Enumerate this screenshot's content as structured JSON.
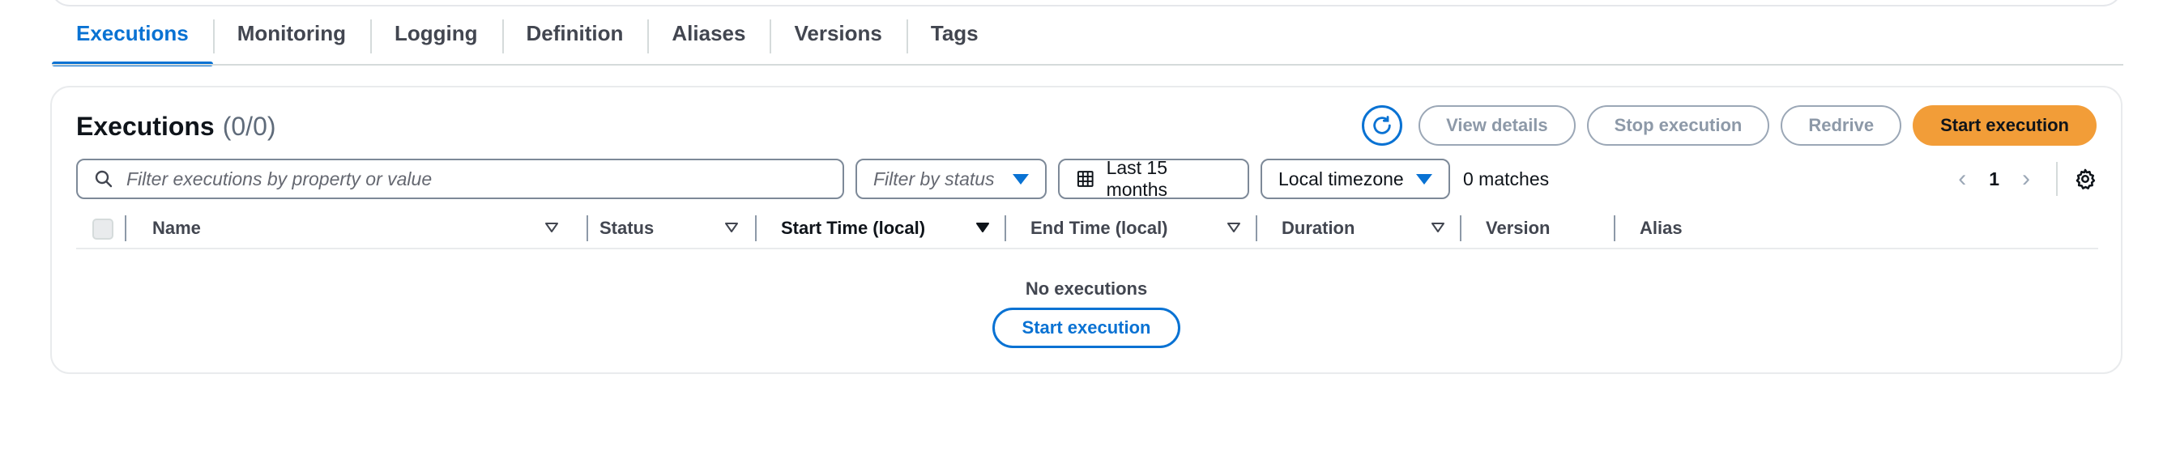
{
  "tabs": [
    {
      "label": "Executions",
      "active": true
    },
    {
      "label": "Monitoring"
    },
    {
      "label": "Logging"
    },
    {
      "label": "Definition"
    },
    {
      "label": "Aliases"
    },
    {
      "label": "Versions"
    },
    {
      "label": "Tags"
    }
  ],
  "card": {
    "title": "Executions",
    "count": "(0/0)"
  },
  "actions": {
    "refresh_icon": "refresh-icon",
    "view_details": "View details",
    "stop_execution": "Stop execution",
    "redrive": "Redrive",
    "start_execution": "Start execution"
  },
  "filters": {
    "search_placeholder": "Filter executions by property or value",
    "status_placeholder": "Filter by status",
    "range": "Last 15 months",
    "timezone": "Local timezone",
    "matches": "0 matches"
  },
  "pagination": {
    "current_page": "1"
  },
  "table": {
    "columns": [
      "Name",
      "Status",
      "Start Time (local)",
      "End Time (local)",
      "Duration",
      "Version",
      "Alias"
    ],
    "sorted_column": "Start Time (local)"
  },
  "empty_state": {
    "text": "No executions",
    "button": "Start execution"
  },
  "colors": {
    "accent": "#0972d3",
    "primary_button": "#f29d38"
  }
}
